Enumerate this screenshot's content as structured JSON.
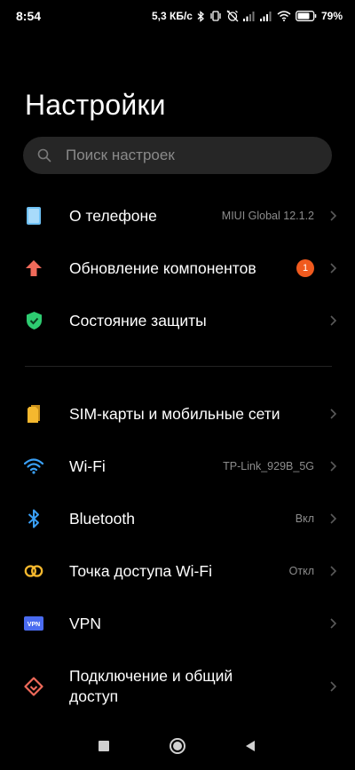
{
  "status_bar": {
    "time": "8:54",
    "speed": "5,3 КБ/с",
    "battery_percent": "79%",
    "battery_level": 0.79
  },
  "title": "Настройки",
  "search": {
    "placeholder": "Поиск настроек"
  },
  "items": [
    {
      "label": "О телефоне",
      "value": "MIUI Global 12.1.2",
      "icon": "phone-icon",
      "color": "#6ec1f5"
    },
    {
      "label": "Обновление компонентов",
      "badge": "1",
      "icon": "arrow-up-icon",
      "color": "#f06a5a"
    },
    {
      "label": "Состояние защиты",
      "icon": "shield-check-icon",
      "color": "#2ecc71"
    },
    {
      "label": "SIM-карты и мобильные сети",
      "icon": "sim-card-icon",
      "color": "#f5b82e"
    },
    {
      "label": "Wi-Fi",
      "value": "TP-Link_929B_5G",
      "icon": "wifi-icon",
      "color": "#3a9ff5"
    },
    {
      "label": "Bluetooth",
      "value": "Вкл",
      "icon": "bluetooth-icon",
      "color": "#3a9ff5"
    },
    {
      "label": "Точка доступа Wi-Fi",
      "value": "Откл",
      "icon": "hotspot-icon",
      "color": "#f5b82e"
    },
    {
      "label": "VPN",
      "icon": "vpn-icon",
      "icon_text": "VPN",
      "color": "#4a6bf0"
    },
    {
      "label_line1": "Подключение и общий",
      "label_line2": "доступ",
      "icon": "connection-share-icon",
      "color": "#f06a5a"
    }
  ]
}
